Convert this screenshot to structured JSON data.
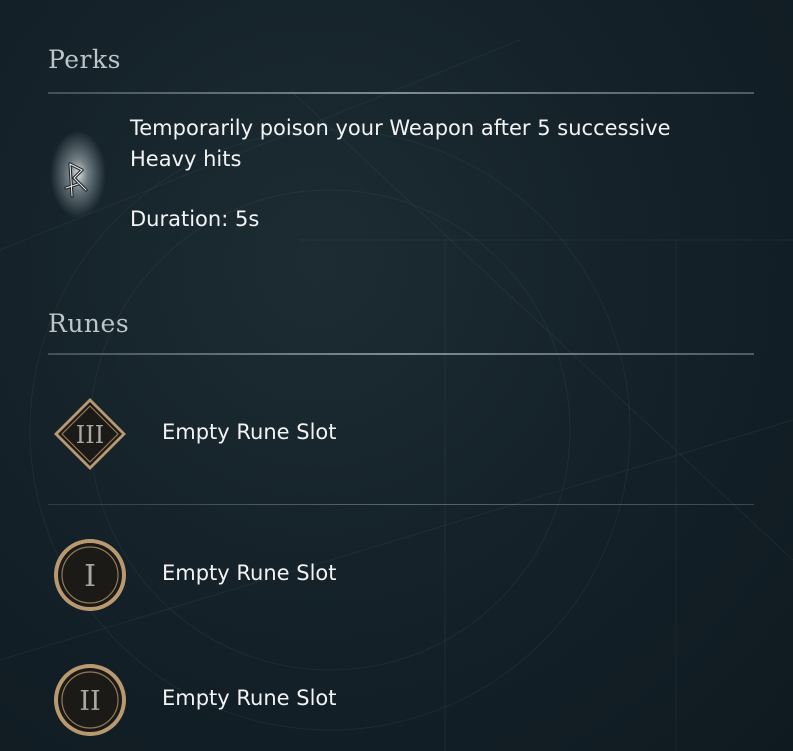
{
  "perks": {
    "title": "Perks",
    "icon": "rune-glyph-icon",
    "description": "Temporarily poison your Weapon after 5 successive Heavy hits",
    "duration": "Duration: 5s"
  },
  "runes": {
    "title": "Runes",
    "slots": [
      {
        "numeral": "III",
        "shape": "diamond",
        "label": "Empty Rune Slot"
      },
      {
        "numeral": "I",
        "shape": "circle",
        "label": "Empty Rune Slot"
      },
      {
        "numeral": "II",
        "shape": "circle",
        "label": "Empty Rune Slot"
      }
    ]
  },
  "colors": {
    "background": "#15222a",
    "text": "#f1f3f4",
    "section_title": "#bcc5c8",
    "badge_gold": "#b99a70"
  }
}
